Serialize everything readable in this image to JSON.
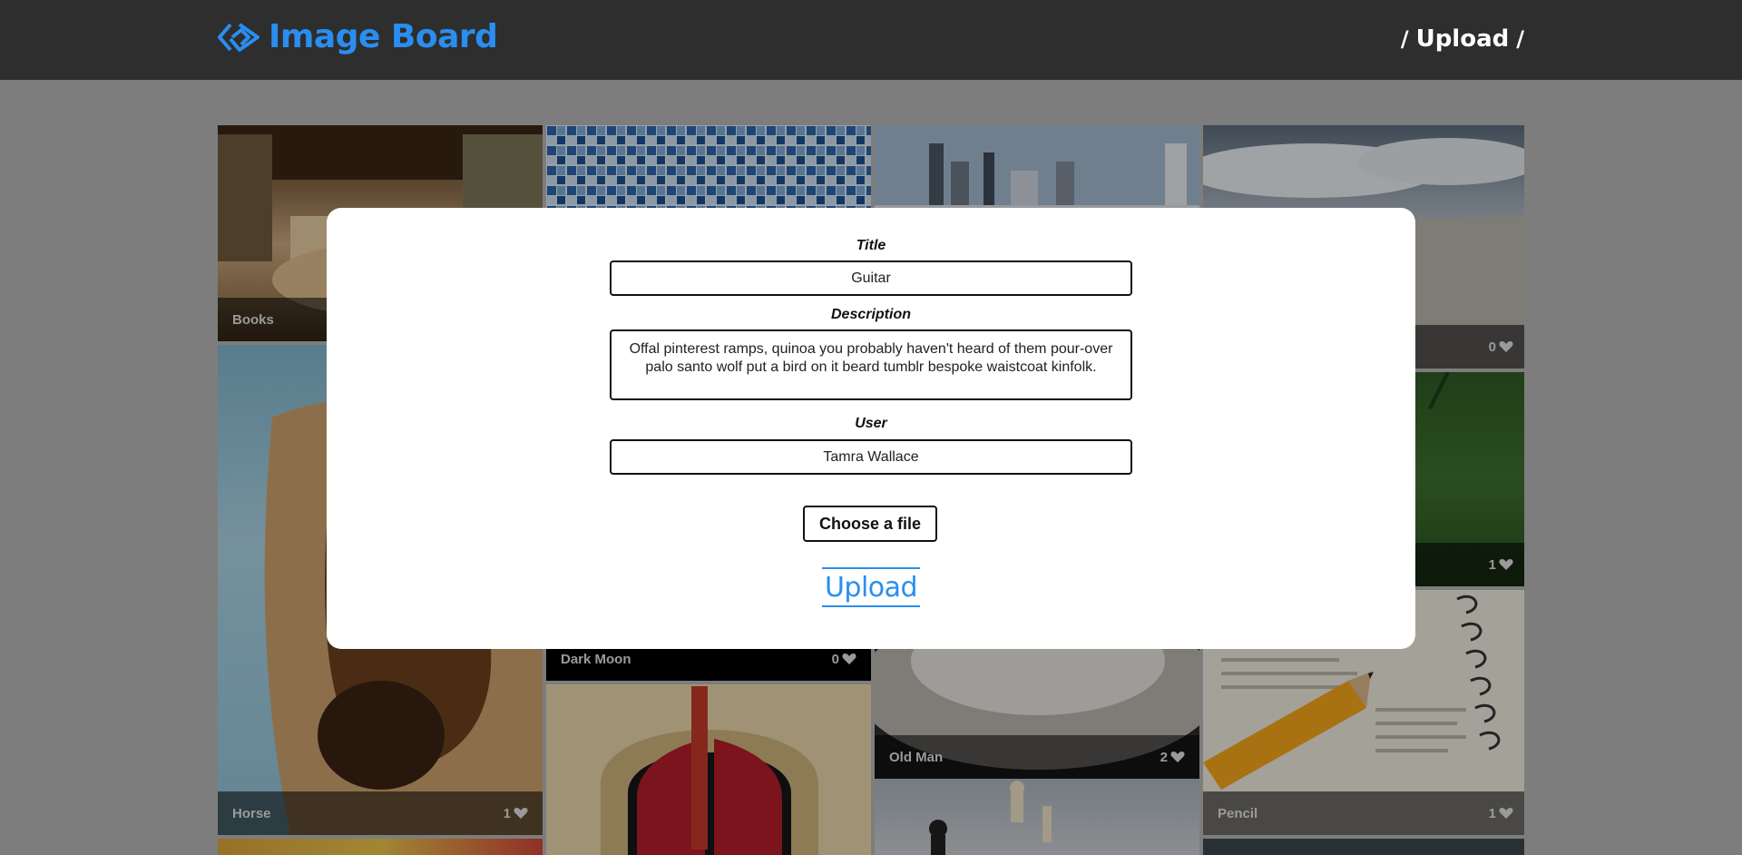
{
  "header": {
    "logo_icon": "diamond-arrows-icon",
    "logo_text": "Image Board",
    "upload_link": "Upload"
  },
  "colors": {
    "accent": "#2a8ef0",
    "header_bg": "#2e2e2e",
    "page_bg": "#b3b3b3"
  },
  "tiles": [
    {
      "title": "Books",
      "likes": "",
      "scene": "books"
    },
    {
      "title": "",
      "likes": "",
      "scene": "mosaic"
    },
    {
      "title": "",
      "likes": "",
      "scene": "city"
    },
    {
      "title": "",
      "likes": "0",
      "scene": "sky"
    },
    {
      "title": "Horse",
      "likes": "1",
      "scene": "horse"
    },
    {
      "title": "",
      "likes": "1",
      "scene": "grass"
    },
    {
      "title": "Dark Moon",
      "likes": "0",
      "scene": "dark-moon"
    },
    {
      "title": "Old Man",
      "likes": "2",
      "scene": "old-man"
    },
    {
      "title": "Pencil",
      "likes": "1",
      "scene": "pencil"
    },
    {
      "title": "",
      "likes": "",
      "scene": "door"
    },
    {
      "title": "",
      "likes": "",
      "scene": "chess"
    }
  ],
  "modal": {
    "title_label": "Title",
    "title_value": "Guitar",
    "description_label": "Description",
    "description_value": "Offal pinterest ramps, quinoa you probably haven't heard of them pour-over palo santo wolf put a bird on it beard tumblr bespoke waistcoat kinfolk.",
    "user_label": "User",
    "user_value": "Tamra Wallace",
    "file_button": "Choose a file",
    "submit": "Upload"
  }
}
